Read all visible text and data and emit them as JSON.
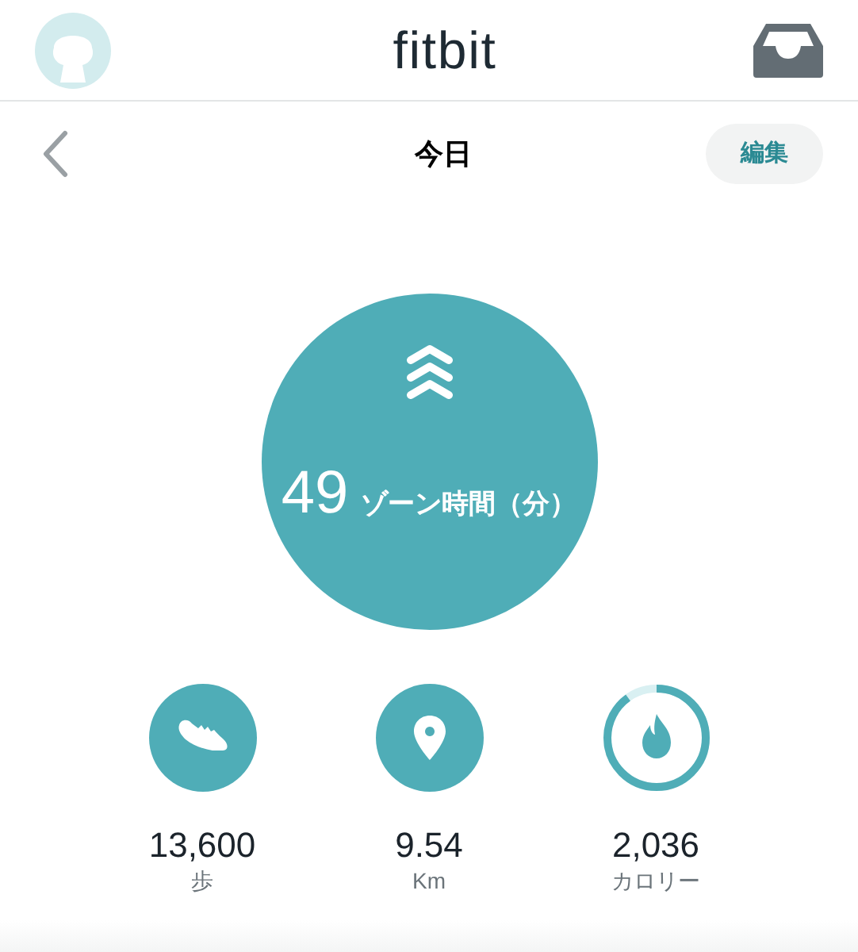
{
  "header": {
    "logo": "fitbit"
  },
  "nav": {
    "title": "今日",
    "edit_button": "編集"
  },
  "zone": {
    "value": "49",
    "label": "ゾーン時間（分）"
  },
  "stats": [
    {
      "kind": "steps",
      "value": "13,600",
      "unit": "歩"
    },
    {
      "kind": "distance",
      "value": "9.54",
      "unit": "Km"
    },
    {
      "kind": "calories",
      "value": "2,036",
      "unit": "カロリー"
    }
  ]
}
